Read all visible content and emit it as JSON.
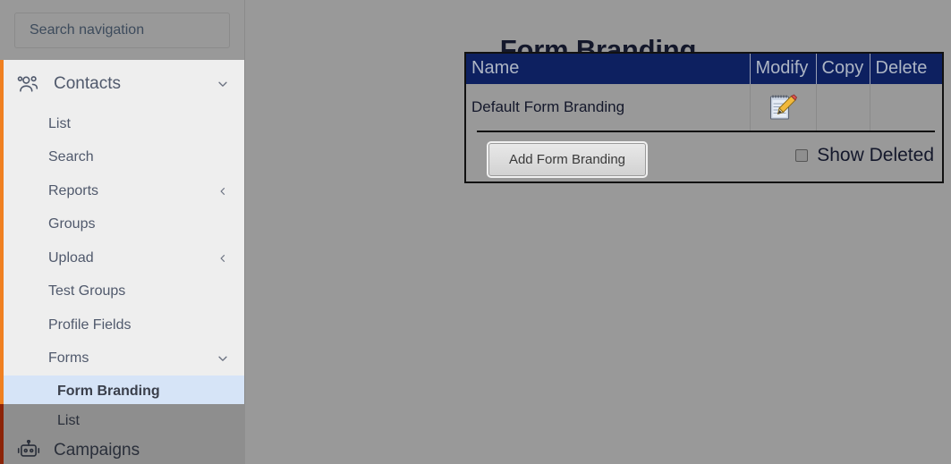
{
  "sidebar": {
    "search": {
      "placeholder": "Search navigation",
      "value": ""
    },
    "groups": [
      {
        "label": "Contacts",
        "icon": "users-icon",
        "expanded": true,
        "chevron": "chevron-down-icon",
        "items": [
          {
            "label": "List",
            "chevron": ""
          },
          {
            "label": "Search",
            "chevron": ""
          },
          {
            "label": "Reports",
            "chevron": "chevron-left-icon"
          },
          {
            "label": "Groups",
            "chevron": ""
          },
          {
            "label": "Upload",
            "chevron": "chevron-left-icon"
          },
          {
            "label": "Test Groups",
            "chevron": ""
          },
          {
            "label": "Profile Fields",
            "chevron": ""
          },
          {
            "label": "Forms",
            "chevron": "chevron-down-icon"
          },
          {
            "label": "Form Branding",
            "chevron": "",
            "active": true
          },
          {
            "label": "List",
            "chevron": ""
          }
        ]
      },
      {
        "label": "Campaigns",
        "icon": "robot-icon",
        "expanded": false,
        "chevron": ""
      }
    ],
    "accent_color": "#f08020",
    "accent_color_dark": "#8c2408",
    "active_color": "#d6e4f7"
  },
  "main": {
    "title": "Form Branding",
    "table": {
      "columns": [
        "Name",
        "Modify",
        "Copy",
        "Delete"
      ],
      "rows": [
        {
          "name": "Default Form Branding",
          "modify_icon": "notepad-pencil-edit-icon",
          "copy": "",
          "delete": ""
        }
      ],
      "header_bg": "#0d2060",
      "header_text_color": "#adb5c4"
    },
    "footer": {
      "add_button_label": "Add Form Branding",
      "show_deleted_label": "Show Deleted",
      "show_deleted_checked": false
    }
  }
}
